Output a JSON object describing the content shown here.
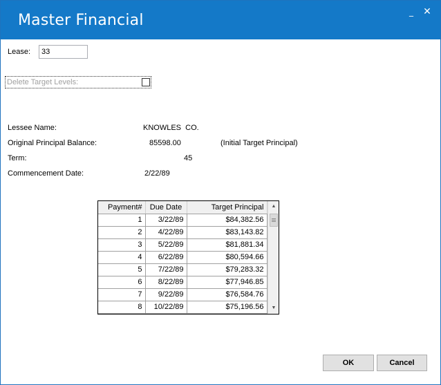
{
  "window": {
    "title": "Master Financial",
    "minimize_glyph": "_",
    "close_glyph": "✕",
    "titlebar_color": "#1479c8"
  },
  "lease": {
    "label": "Lease:",
    "value": "33"
  },
  "delete_target": {
    "label": "Delete Target Levels:",
    "checked": false
  },
  "info": {
    "lessee_name_label": "Lessee Name:",
    "lessee_name_value": "KNOWLES  CO.",
    "principal_label": "Original Principal Balance:",
    "principal_value": "85598.00",
    "principal_note": "(Initial Target Principal)",
    "term_label": "Term:",
    "term_value": "45",
    "commencement_label": "Commencement Date:",
    "commencement_value": "2/22/89"
  },
  "schedule": {
    "columns": [
      "Payment#",
      "Due Date",
      "Target Principal"
    ],
    "rows": [
      [
        "1",
        "3/22/89",
        "$84,382.56"
      ],
      [
        "2",
        "4/22/89",
        "$83,143.82"
      ],
      [
        "3",
        "5/22/89",
        "$81,881.34"
      ],
      [
        "4",
        "6/22/89",
        "$80,594.66"
      ],
      [
        "5",
        "7/22/89",
        "$79,283.32"
      ],
      [
        "6",
        "8/22/89",
        "$77,946.85"
      ],
      [
        "7",
        "9/22/89",
        "$76,584.76"
      ],
      [
        "8",
        "10/22/89",
        "$75,196.56"
      ]
    ]
  },
  "buttons": {
    "ok": "OK",
    "cancel": "Cancel"
  }
}
